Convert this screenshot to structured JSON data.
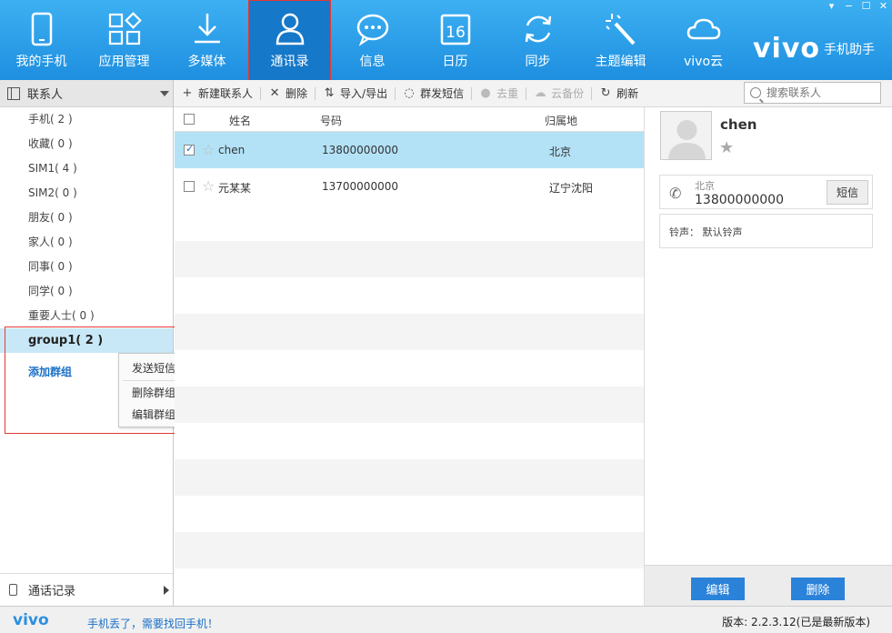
{
  "window_controls": [
    "▾",
    "−",
    "☐",
    "✕"
  ],
  "nav": [
    {
      "label": "我的手机",
      "icon": "phone-icon"
    },
    {
      "label": "应用管理",
      "icon": "apps-icon"
    },
    {
      "label": "多媒体",
      "icon": "download-icon"
    },
    {
      "label": "通讯录",
      "icon": "contacts-icon",
      "active": true
    },
    {
      "label": "信息",
      "icon": "message-icon"
    },
    {
      "label": "日历",
      "icon": "calendar-icon",
      "badge": "16"
    },
    {
      "label": "同步",
      "icon": "sync-icon"
    },
    {
      "label": "主题编辑",
      "icon": "magic-wand-icon"
    },
    {
      "label": "vivo云",
      "icon": "cloud-icon"
    }
  ],
  "brand": {
    "logo": "vivo",
    "subtitle": "手机助手"
  },
  "sidebar": {
    "header": "联系人",
    "groups": [
      "手机( 2 )",
      "收藏( 0 )",
      "SIM1( 4 )",
      "SIM2( 0 )",
      "朋友( 0 )",
      "家人( 0 )",
      "同事( 0 )",
      "同学( 0 )",
      "重要人士( 0 )",
      "group1( 2 )"
    ],
    "selected_index": 9,
    "add_group": "添加群组",
    "footer": "通话记录"
  },
  "context_menu": [
    "发送短信",
    "删除群组",
    "编辑群组"
  ],
  "toolbar": {
    "new_contact": "新建联系人",
    "delete": "删除",
    "import_export": "导入/导出",
    "group_sms": "群发短信",
    "dedupe": "去重",
    "cloud_backup": "云备份",
    "refresh": "刷新"
  },
  "search": {
    "placeholder": "搜索联系人"
  },
  "table": {
    "headers": {
      "name": "姓名",
      "number": "号码",
      "location": "归属地"
    },
    "rows": [
      {
        "name": "chen",
        "number": "13800000000",
        "location": "北京",
        "checked": true
      },
      {
        "name": "元某某",
        "number": "13700000000",
        "location": "辽宁沈阳",
        "checked": false
      }
    ]
  },
  "details": {
    "name": "chen",
    "location": "北京",
    "number": "13800000000",
    "sms_label": "短信",
    "ringtone": "铃声： 默认铃声",
    "edit_label": "编辑",
    "delete_label": "删除"
  },
  "status": {
    "logo": "vivo",
    "lost_phone": "手机丢了，需要找回手机！",
    "version": "版本: 2.2.3.12(已是最新版本)"
  },
  "colors": {
    "top_bar": "#1e8fe0",
    "active_tab": "#1578c8",
    "selection": "#b3e2f7",
    "button": "#2b82d9",
    "highlight_box": "#e53935"
  }
}
